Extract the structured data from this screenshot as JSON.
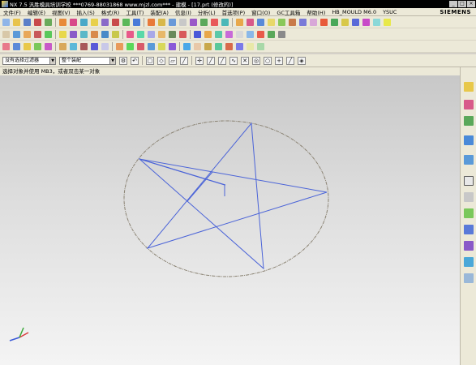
{
  "window": {
    "title": "NX 7.5 汎胜模具培训学校 ***0769-88031868 www.mjzl.com*** - 建模 - [17.prt (修改的)]",
    "min": "_",
    "max": "□",
    "close": "×"
  },
  "menu": {
    "items": [
      "文件(F)",
      "编辑(E)",
      "视图(V)",
      "插入(S)",
      "格式(R)",
      "工具(T)",
      "装配(A)",
      "信息(I)",
      "分析(L)",
      "首选项(P)",
      "窗口(O)",
      "GC工具箱",
      "帮助(H)",
      "HB_MOULD M6.0",
      "YSUC"
    ],
    "brand": "SIEMENS"
  },
  "selection": {
    "filter_value": "没有选择过滤器",
    "scope_value": "整个装配"
  },
  "status": {
    "prompt": "选择对象并使用 MB3，或者双击某一对象"
  },
  "colors": {
    "curve": "#4a63d8",
    "circle": "#8a8272",
    "menubar": "#ece9d8",
    "background_top": "#c8c8c8",
    "background_bottom": "#f4f4f4"
  },
  "icons": {
    "snap": [
      "point-snap-icon",
      "end-point-icon",
      "mid-point-icon",
      "control-point-icon",
      "intersection-icon",
      "center-icon",
      "quadrant-icon",
      "existing-point-icon",
      "point-on-curve-icon",
      "point-on-face-icon"
    ]
  }
}
